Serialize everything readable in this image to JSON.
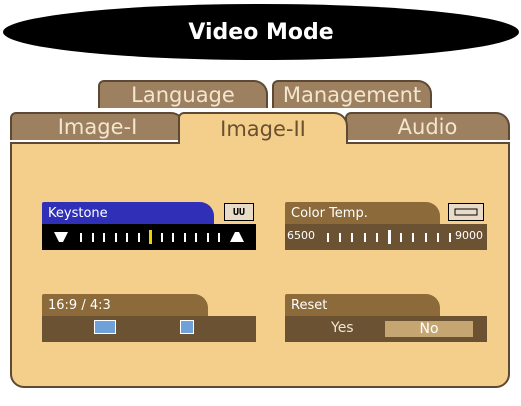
{
  "header": {
    "title": "Video Mode"
  },
  "tabs": {
    "language": "Language",
    "management": "Management",
    "image1": "Image-I",
    "image2": "Image-II",
    "audio": "Audio"
  },
  "keystone": {
    "label": "Keystone",
    "reset_icon_text": "UU",
    "level": 0.5
  },
  "color_temp": {
    "label": "Color Temp.",
    "min": "6500",
    "max": "9000",
    "level": 0.45
  },
  "aspect": {
    "label": "16:9 / 4:3"
  },
  "reset": {
    "label": "Reset",
    "yes": "Yes",
    "no": "No"
  },
  "colors": {
    "panel": "#f4cf8c",
    "tab_inactive": "#9c8060",
    "keystone_head": "#2f30b7",
    "group_head": "#8c6a3a"
  }
}
